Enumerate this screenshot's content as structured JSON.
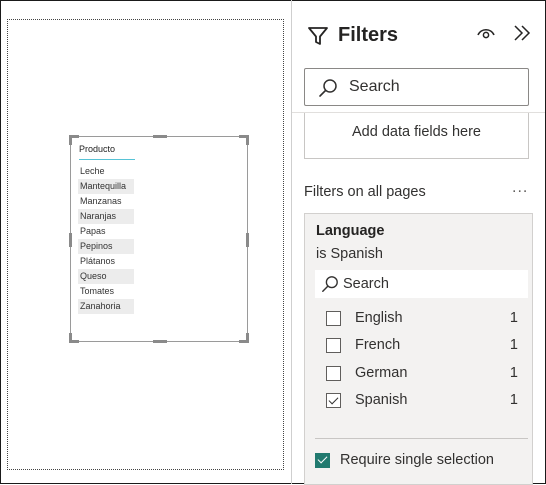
{
  "canvas": {
    "table": {
      "header": "Producto",
      "rows": [
        "Leche",
        "Mantequilla",
        "Manzanas",
        "Naranjas",
        "Papas",
        "Pepinos",
        "Plátanos",
        "Queso",
        "Tomates",
        "Zanahoria"
      ]
    }
  },
  "filters_pane": {
    "title": "Filters",
    "search_placeholder": "Search",
    "add_fields_label": "Add data fields here",
    "section_label": "Filters on all pages",
    "section_more": "...",
    "filter_card": {
      "field": "Language",
      "summary": "is Spanish",
      "search_placeholder": "Search",
      "options": [
        {
          "label": "English",
          "count": "1",
          "checked": false
        },
        {
          "label": "French",
          "count": "1",
          "checked": false
        },
        {
          "label": "German",
          "count": "1",
          "checked": false
        },
        {
          "label": "Spanish",
          "count": "1",
          "checked": true
        }
      ],
      "require_single_selection_label": "Require single selection",
      "require_single_selection_checked": true
    }
  },
  "icons": {
    "filter": "filter-funnel-icon",
    "eye": "eye-icon",
    "collapse": "double-chevron-right-icon",
    "search": "search-icon"
  },
  "colors": {
    "accent": "#217a6f",
    "table_header_underline": "#57c3d6"
  }
}
